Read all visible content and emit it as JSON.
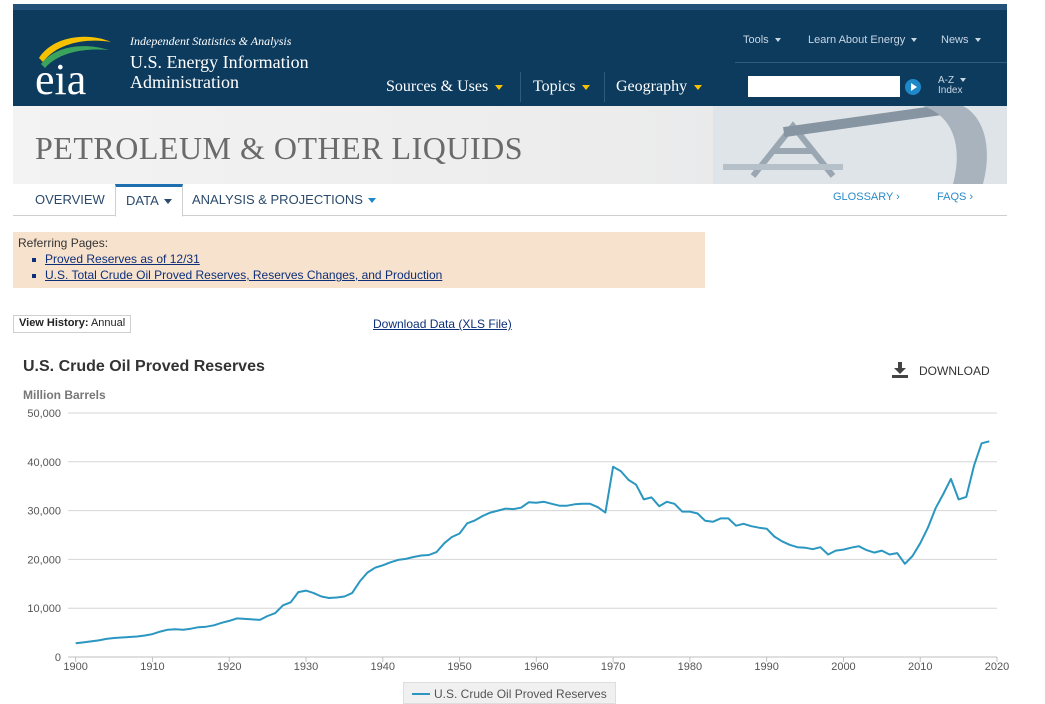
{
  "header": {
    "tagline": "Independent Statistics & Analysis",
    "org_name": "U.S. Energy Information Administration",
    "logo_text": "eia",
    "top_nav": [
      "Tools",
      "Learn About Energy",
      "News"
    ],
    "main_nav": [
      "Sources & Uses",
      "Topics",
      "Geography"
    ],
    "search": {
      "value": "",
      "placeholder": ""
    },
    "az_index": [
      "A-Z",
      "Index"
    ]
  },
  "banner": {
    "title": "PETROLEUM & OTHER LIQUIDS"
  },
  "tabs": [
    {
      "label": "OVERVIEW"
    },
    {
      "label": "DATA",
      "active": true
    },
    {
      "label": "ANALYSIS & PROJECTIONS"
    }
  ],
  "right_links": [
    "GLOSSARY ›",
    "FAQS ›"
  ],
  "referring": {
    "heading": "Referring Pages:",
    "links": [
      "Proved Reserves as of 12/31",
      "U.S. Total Crude Oil Proved Reserves, Reserves Changes, and Production"
    ]
  },
  "view_history": {
    "label": "View History:",
    "value": "Annual"
  },
  "download_data": "Download Data (XLS File)",
  "download_button": "DOWNLOAD",
  "colors": {
    "header_bg": "#0d3b5e",
    "series": "#2b97c0",
    "accent": "#f6c200",
    "link": "#0d2f7a"
  },
  "chart_data": {
    "type": "line",
    "title": "U.S. Crude Oil Proved Reserves",
    "ylabel": "Million Barrels",
    "xlabel": "",
    "xlim": [
      1899,
      2020
    ],
    "ylim": [
      0,
      50000
    ],
    "y_ticks": [
      "0",
      "10,000",
      "20,000",
      "30,000",
      "40,000",
      "50,000"
    ],
    "x_ticks": [
      "1900",
      "1910",
      "1920",
      "1930",
      "1940",
      "1950",
      "1960",
      "1970",
      "1980",
      "1990",
      "2000",
      "2010",
      "2020"
    ],
    "grid": true,
    "legend_position": "bottom-center",
    "series": [
      {
        "name": "U.S. Crude Oil Proved Reserves",
        "color": "#2b97c0",
        "x": [
          1900,
          1901,
          1902,
          1903,
          1904,
          1905,
          1906,
          1907,
          1908,
          1909,
          1910,
          1911,
          1912,
          1913,
          1914,
          1915,
          1916,
          1917,
          1918,
          1919,
          1920,
          1921,
          1922,
          1923,
          1924,
          1925,
          1926,
          1927,
          1928,
          1929,
          1930,
          1931,
          1932,
          1933,
          1934,
          1935,
          1936,
          1937,
          1938,
          1939,
          1940,
          1941,
          1942,
          1943,
          1944,
          1945,
          1946,
          1947,
          1948,
          1949,
          1950,
          1951,
          1952,
          1953,
          1954,
          1955,
          1956,
          1957,
          1958,
          1959,
          1960,
          1961,
          1962,
          1963,
          1964,
          1965,
          1966,
          1967,
          1968,
          1969,
          1970,
          1971,
          1972,
          1973,
          1974,
          1975,
          1976,
          1977,
          1978,
          1979,
          1980,
          1981,
          1982,
          1983,
          1984,
          1985,
          1986,
          1987,
          1988,
          1989,
          1990,
          1991,
          1992,
          1993,
          1994,
          1995,
          1996,
          1997,
          1998,
          1999,
          2000,
          2001,
          2002,
          2003,
          2004,
          2005,
          2006,
          2007,
          2008,
          2009,
          2010,
          2011,
          2012,
          2013,
          2014,
          2015,
          2016,
          2017,
          2018,
          2019
        ],
        "values": [
          2800,
          3000,
          3200,
          3400,
          3700,
          3900,
          4000,
          4100,
          4200,
          4400,
          4700,
          5200,
          5600,
          5700,
          5600,
          5800,
          6100,
          6200,
          6500,
          7000,
          7400,
          7900,
          7800,
          7700,
          7600,
          8400,
          9000,
          10600,
          11200,
          13300,
          13600,
          13100,
          12400,
          12100,
          12200,
          12400,
          13100,
          15500,
          17300,
          18300,
          18800,
          19400,
          19900,
          20100,
          20500,
          20800,
          20900,
          21500,
          23300,
          24600,
          25300,
          27400,
          28000,
          28900,
          29600,
          30000,
          30400,
          30300,
          30600,
          31700,
          31600,
          31800,
          31400,
          31000,
          31000,
          31300,
          31400,
          31400,
          30700,
          29600,
          39000,
          38100,
          36300,
          35300,
          32300,
          32700,
          30900,
          31800,
          31400,
          29800,
          29800,
          29400,
          27900,
          27700,
          28400,
          28400,
          26900,
          27300,
          26800,
          26500,
          26300,
          24700,
          23700,
          23000,
          22500,
          22400,
          22100,
          22500,
          21000,
          21800,
          22000,
          22400,
          22700,
          21900,
          21400,
          21800,
          21000,
          21300,
          19100,
          20700,
          23300,
          26500,
          30500,
          33400,
          36500,
          32300,
          32800,
          39200,
          43800,
          44200
        ]
      }
    ]
  }
}
